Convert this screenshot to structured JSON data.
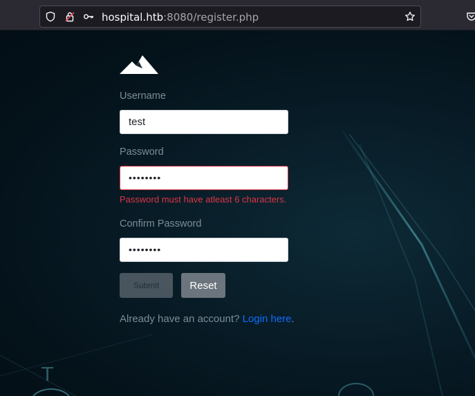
{
  "browser": {
    "url_host": "hospital.htb",
    "url_rest": ":8080/register.php"
  },
  "form": {
    "username_label": "Username",
    "username_value": "test",
    "password_label": "Password",
    "password_value": "••••••••",
    "password_error": "Password must have atleast 6 characters.",
    "confirm_label": "Confirm Password",
    "confirm_value": "••••••••",
    "submit_label": "Submit",
    "reset_label": "Reset"
  },
  "footer": {
    "prompt": "Already have an account?",
    "link": "Login here",
    "suffix": "."
  },
  "background": {
    "letter": "T"
  },
  "colors": {
    "error": "#dc3545",
    "link": "#0d6efd",
    "button_gray": "#6c757d"
  }
}
